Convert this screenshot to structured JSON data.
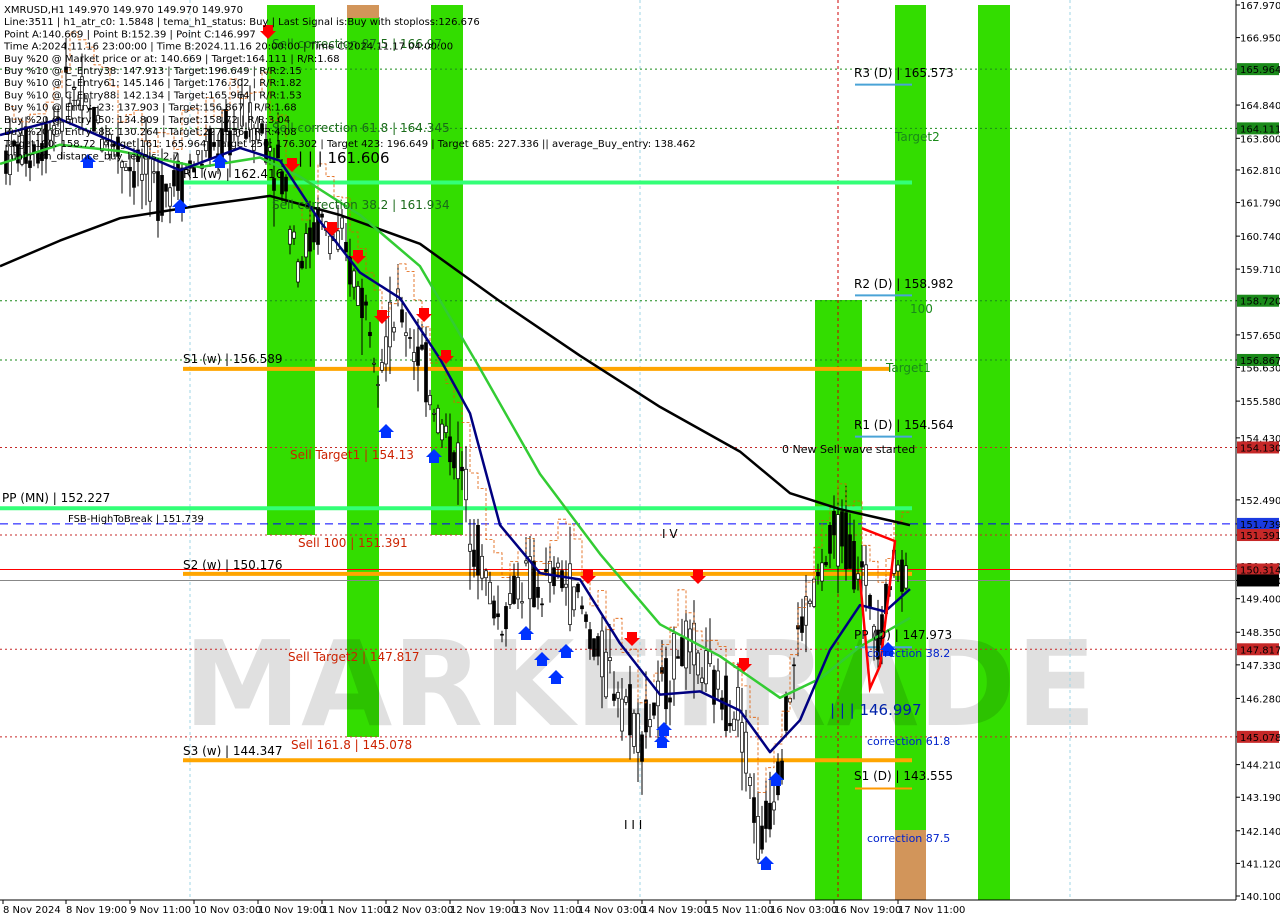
{
  "header": {
    "lines": [
      "XMRUSD,H1  149.970 149.970 149.970 149.970",
      "Line:3511 | h1_atr_c0: 1.5848 | tema_h1_status: Buy | Last Signal is:Buy with stoploss:126.676",
      "Point A:140.669 | Point B:152.39 | Point C:146.997",
      "Time A:2024.11.16 23:00:00 | Time B:2024.11.16 20:00:00 | Time C:2024.11.17 04:00:00",
      "Buy %20 @ Market price or at: 140.669 | Target:164.111 | R/R:1.68",
      "Buy %10 @ C_Entry38: 147.913 | Target:196.649 | R/R:2.15",
      "Buy %10 @ C_Entry61: 145.146 | Target:176.302 | R/R:1.82",
      "Buy %10 @ C_Entry88: 142.134 | Target:165.964 | R/R:1.53",
      "Buy %10 @ Entry -23: 137.903 | Target:156.867 | R/R:1.68",
      "Buy %20 @ Entry -50: 134.809 | Target:158.72 | R/R:3.04",
      "Buy %20 @ Entry -88: 130.264 | Target:227.336 | R/R:4.08",
      "Target100: 158.72 | Target 161: 165.964 | Target 250: 176.302 | Target 423: 196.649 | Target 685: 227.336 || average_Buy_entry: 138.462",
      "minimum_distance_buy_levels: 2.7"
    ]
  },
  "watermark": "MARKETRADE",
  "colors": {
    "green_band": "#33dd00",
    "orange_band": "#d2955a",
    "pivot_line": "#ffa500",
    "pp_line": "#33ff77",
    "ma_black": "#000000",
    "ma_green": "#33cc33",
    "ma_navy": "#000080",
    "down_arrow": "#ff0000",
    "up_arrow": "#0033ff",
    "sell_text": "#cc2200",
    "blue_dashed": "#0000ff",
    "red_solid": "#ff0000"
  },
  "chart_data": {
    "type": "candlestick",
    "symbol": "XMRUSD",
    "timeframe": "H1",
    "y_range": [
      139.9,
      167.97
    ],
    "y_ticks": [
      "167.970",
      "166.950",
      "165.964",
      "164.840",
      "164.111",
      "163.800",
      "162.810",
      "161.790",
      "160.740",
      "159.710",
      "158.720",
      "157.650",
      "156.867",
      "156.630",
      "155.580",
      "154.430",
      "154.130",
      "152.490",
      "151.739",
      "151.391",
      "150.420",
      "149.970",
      "149.400",
      "148.350",
      "147.817",
      "147.330",
      "146.280",
      "145.078",
      "144.210",
      "143.190",
      "142.140",
      "141.120",
      "140.100"
    ],
    "highlighted_ticks": [
      {
        "value": "165.964",
        "color": "#1a8a1a"
      },
      {
        "value": "164.111",
        "color": "#1a8a1a"
      },
      {
        "value": "158.720",
        "color": "#1a8a1a"
      },
      {
        "value": "156.867",
        "color": "#1a8a1a"
      },
      {
        "value": "154.130",
        "color": "#c62828"
      },
      {
        "value": "151.739",
        "color": "#1a3ae0"
      },
      {
        "value": "151.391",
        "color": "#c62828"
      },
      {
        "value": "150.314",
        "color": "#c62828"
      },
      {
        "value": "149.970",
        "color": "#000000"
      },
      {
        "value": "147.817",
        "color": "#c62828"
      },
      {
        "value": "145.078",
        "color": "#c62828"
      }
    ],
    "x_labels": [
      "8 Nov 2024",
      "8 Nov 19:00",
      "9 Nov 11:00",
      "10 Nov 03:00",
      "10 Nov 19:00",
      "11 Nov 11:00",
      "12 Nov 03:00",
      "12 Nov 19:00",
      "13 Nov 11:00",
      "14 Nov 03:00",
      "14 Nov 19:00",
      "15 Nov 11:00",
      "16 Nov 03:00",
      "16 Nov 19:00",
      "17 Nov 11:00"
    ],
    "level_labels": {
      "r3": "R3 (D) | 165.573",
      "r2": "R2 (D) | 158.982",
      "r1": "R1 (D) | 154.564",
      "pp_d": "PP (D) | 147.973",
      "s1_d": "S1 (D) | 143.555",
      "pp_mn": "PP (MN) | 152.227",
      "s1_w": "S1 (w) | 156.589",
      "s2_w": "S2 (w) | 150.176",
      "s3_w": "S3 (w) | 144.347",
      "r1_w": "R1 (w) | 162.416",
      "fsb": "FSB-HighToBreak | 151.739",
      "sell_target1": "Sell Target1 | 154.13",
      "sell_100": "Sell 100 | 151.391",
      "sell_target2": "Sell Target2 | 147.817",
      "sell_1618": "Sell 161.8 | 145.078",
      "sell_corr_875": "Sell correction 87.5 | 166.97",
      "sell_corr_618": "Sell correction 61.8 | 164.345",
      "sell_corr_382": "Sell correction 38.2 | 161.934",
      "level_161606": "| | | 161.606",
      "level_146997": "| | | 146.997",
      "new_sell_wave": "0 New Sell wave started",
      "target1": "Target1",
      "target2": "Target2",
      "t100": "100",
      "corr_382": "correction 38.2",
      "corr_618": "correction 61.8",
      "corr_875": "correction 87.5",
      "iv_mark": "I V",
      "iii_mark": "I I I"
    }
  }
}
